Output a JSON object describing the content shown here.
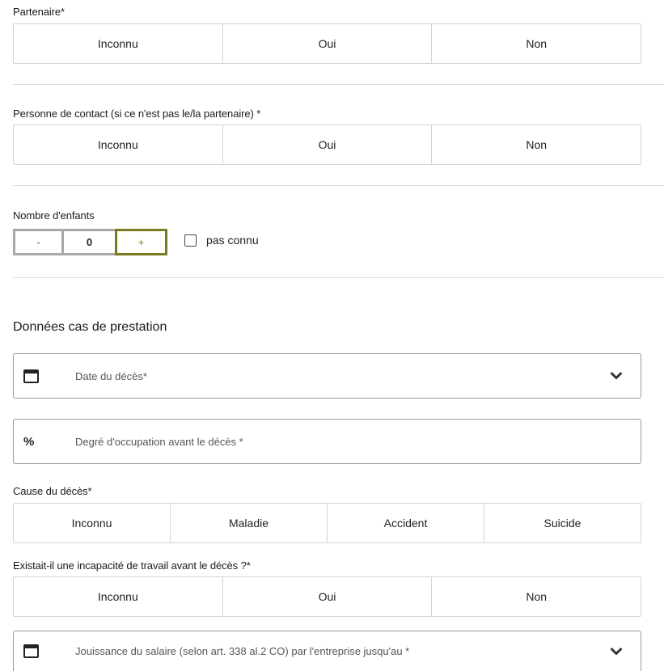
{
  "partenaire": {
    "label": "Partenaire*",
    "options": [
      "Inconnu",
      "Oui",
      "Non"
    ]
  },
  "contact": {
    "label": "Personne de contact (si ce n'est pas le/la partenaire) *",
    "options": [
      "Inconnu",
      "Oui",
      "Non"
    ]
  },
  "enfants": {
    "label": "Nombre d'enfants",
    "minus": "-",
    "value": "0",
    "plus": "+",
    "unknown_label": "pas connu"
  },
  "prestation": {
    "title": "Données cas de prestation",
    "date_deces_placeholder": "Date du décès*",
    "degre_occupation_placeholder": "Degré d'occupation avant le décès *",
    "percent_symbol": "%",
    "cause": {
      "label": "Cause du décès*",
      "options": [
        "Inconnu",
        "Maladie",
        "Accident",
        "Suicide"
      ]
    },
    "incapacite": {
      "label": "Existait-il une incapacité de travail avant le décès ?*",
      "options": [
        "Inconnu",
        "Oui",
        "Non"
      ]
    },
    "jouissance_placeholder": "Jouissance du salaire (selon art. 338 al.2 CO) par l'entreprise jusqu'au *"
  }
}
